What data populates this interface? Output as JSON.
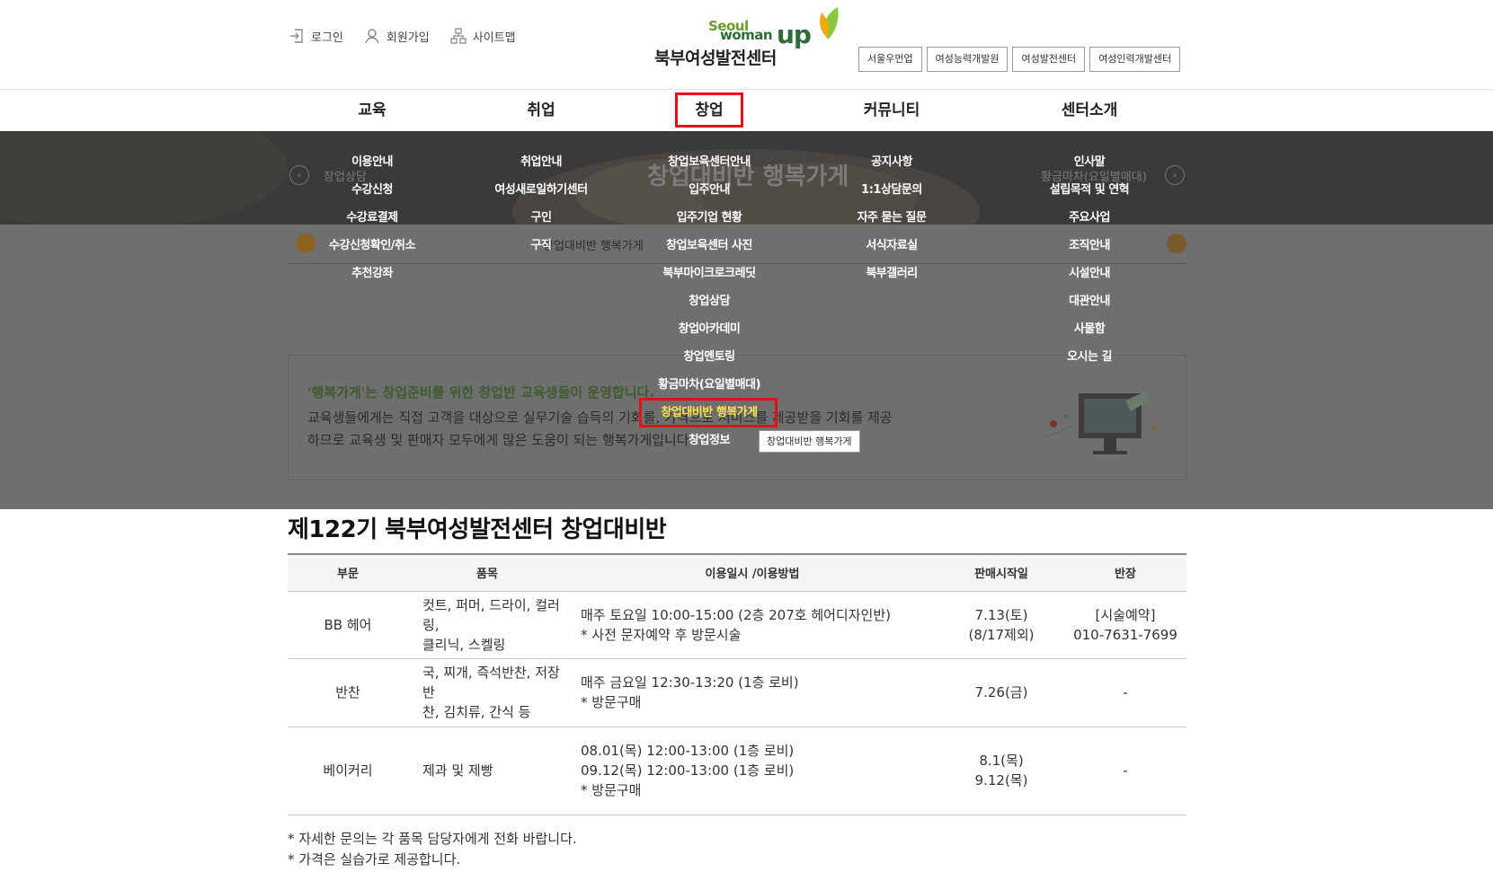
{
  "util": {
    "login": "로그인",
    "join": "회원가입",
    "sitemap": "사이트맵"
  },
  "logo": {
    "seoul": "Seoul",
    "woman": "woman",
    "up": "up",
    "name": "북부여성발전센터"
  },
  "family_sites": [
    "서울우먼업",
    "여성능력개발원",
    "여성발전센터",
    "여성인력개발센터"
  ],
  "gnb": [
    "교육",
    "취업",
    "창업",
    "커뮤니티",
    "센터소개"
  ],
  "visual": {
    "title": "창업대비반 행복가게",
    "prev_label": "창업상담",
    "next_label": "황금마차(요일별매대)"
  },
  "location": {
    "current": "창업대비반 행복가게"
  },
  "dropdown": {
    "col1": [
      "이용안내",
      "수강신청",
      "수강료결제",
      "수강신청확인/취소",
      "추천강좌"
    ],
    "col2": [
      "취업안내",
      "여성새로일하기센터",
      "구인",
      "구직"
    ],
    "col3": [
      "창업보육센터안내",
      "입주안내",
      "입주기업 현황",
      "창업보육센터 사진",
      "북부마이크로크레딧",
      "창업상담",
      "창업아카데미",
      "창업멘토링",
      "황금마차(요일별매대)",
      "창업대비반 행복가게",
      "창업정보"
    ],
    "col4": [
      "공지사항",
      "1:1상담문의",
      "자주 묻는 질문",
      "서식자료실",
      "북부갤러리"
    ],
    "col5": [
      "인사말",
      "설립목적 및 연혁",
      "주요사업",
      "조직안내",
      "시설안내",
      "대관안내",
      "사물함",
      "오시는 길"
    ],
    "active_item": "창업대비반 행복가게",
    "tooltip": "창업대비반 행복가게"
  },
  "intro": {
    "line1": "'행복가게'는 창업준비를 위한 창업반 교육생들이 운영합니다.",
    "line2": "교육생들에게는 직접 고객을 대상으로 실무기술 습득의 기회를,                                    가격으로 서비스를 제공받을 기회를 제공",
    "line3": "하므로 교육생 및 판매자 모두에게 많은 도움이 되는 행복가게입니다."
  },
  "content": {
    "title": "제122기 북부여성발전센터 창업대비반",
    "columns": [
      "부문",
      "품목",
      "이용일시 /이용방법",
      "판매시작일",
      "반장"
    ],
    "rows": [
      {
        "category": "BB 헤어",
        "items": [
          "컷트, 퍼머, 드라이, 컬러링,",
          "클리닉, 스켈링"
        ],
        "schedule": [
          "매주 토요일 10:00-15:00 (2층 207호 헤어디자인반)",
          "* 사전 문자예약 후 방문시술"
        ],
        "start": [
          "7.13(토)",
          "(8/17제외)"
        ],
        "leader": [
          "[시술예약]",
          "010-7631-7699"
        ]
      },
      {
        "category": "반찬",
        "items": [
          "국, 찌개, 즉석반찬, 저장반",
          "찬, 김치류, 간식 등"
        ],
        "schedule": [
          "매주 금요일 12:30-13:20 (1층 로비)",
          "* 방문구매"
        ],
        "start": [
          "7.26(금)"
        ],
        "leader": [
          "-"
        ]
      },
      {
        "category": "베이커리",
        "items": [
          "제과 및 제빵"
        ],
        "schedule": [
          "08.01(목) 12:00-13:00 (1층 로비)",
          "09.12(목) 12:00-13:00 (1층 로비)",
          "* 방문구매"
        ],
        "start": [
          "8.1(목)",
          "9.12(목)"
        ],
        "leader": [
          "-"
        ]
      }
    ],
    "notes": [
      "* 자세한 문의는 각 품목 담당자에게 전화 바랍니다.",
      "* 가격은 실습가로 제공합니다."
    ]
  },
  "colors": {
    "highlight_border": "#e0111b",
    "active_menu_text": "#ffe44d",
    "overlay": "#6f6f6f",
    "brand_green": "#2f6b3a"
  }
}
